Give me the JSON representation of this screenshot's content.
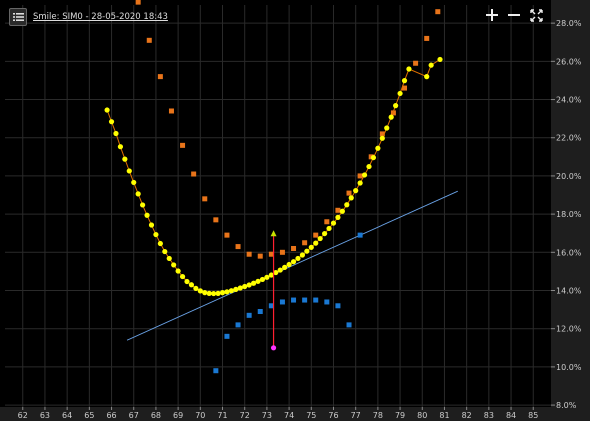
{
  "header": {
    "title": "Smile: SIM0 - 28-05-2020 18:43",
    "menu_icon": "list-icon",
    "tools": [
      {
        "name": "zoom-in-icon"
      },
      {
        "name": "zoom-out-icon"
      },
      {
        "name": "fit-icon"
      }
    ]
  },
  "colors": {
    "background": "#000000",
    "axis_panel": "#1e1e1e",
    "smile": "#ffff00",
    "smile_line": "#e07000",
    "ask": "#e8741a",
    "bid": "#1a78d2",
    "trend": "#6aa2e6",
    "marker_line": "#ff2030",
    "marker_top": "#c8e000",
    "marker_bottom": "#ff33ff",
    "grid": "#2a2a2a"
  },
  "chart_data": {
    "type": "scatter",
    "x_ticks": [
      "62",
      "63",
      "64",
      "65",
      "66",
      "67",
      "68",
      "69",
      "70",
      "71",
      "72",
      "73",
      "74",
      "75",
      "76",
      "77",
      "78",
      "79",
      "80",
      "81",
      "82",
      "83",
      "84",
      "85"
    ],
    "y_ticks": [
      "8.0%",
      "10.0%",
      "12.0%",
      "14.0%",
      "16.0%",
      "18.0%",
      "20.0%",
      "22.0%",
      "24.0%",
      "26.0%",
      "28.0%"
    ],
    "xlim": [
      61.2,
      85.8
    ],
    "ylim": [
      7.9,
      28.95
    ],
    "grid": true,
    "series": [
      {
        "name": "",
        "kind": "smile",
        "points": [
          [
            65.8,
            23.45
          ],
          [
            66.0,
            22.84
          ],
          [
            66.2,
            22.22
          ],
          [
            66.4,
            21.53
          ],
          [
            66.6,
            20.88
          ],
          [
            66.8,
            20.26
          ],
          [
            67.0,
            19.66
          ],
          [
            67.2,
            19.06
          ],
          [
            67.4,
            18.48
          ],
          [
            67.6,
            17.94
          ],
          [
            67.8,
            17.43
          ],
          [
            68.0,
            16.93
          ],
          [
            68.2,
            16.46
          ],
          [
            68.4,
            16.04
          ],
          [
            68.6,
            15.68
          ],
          [
            68.8,
            15.34
          ],
          [
            69.0,
            15.02
          ],
          [
            69.2,
            14.73
          ],
          [
            69.4,
            14.47
          ],
          [
            69.6,
            14.3
          ],
          [
            69.8,
            14.11
          ],
          [
            70.0,
            13.98
          ],
          [
            70.2,
            13.89
          ],
          [
            70.4,
            13.85
          ],
          [
            70.6,
            13.84
          ],
          [
            70.8,
            13.85
          ],
          [
            71.0,
            13.89
          ],
          [
            71.2,
            13.93
          ],
          [
            71.4,
            13.99
          ],
          [
            71.6,
            14.06
          ],
          [
            71.8,
            14.13
          ],
          [
            72.0,
            14.21
          ],
          [
            72.2,
            14.29
          ],
          [
            72.4,
            14.38
          ],
          [
            72.6,
            14.48
          ],
          [
            72.8,
            14.58
          ],
          [
            73.0,
            14.69
          ],
          [
            73.2,
            14.81
          ],
          [
            73.4,
            14.94
          ],
          [
            73.6,
            15.07
          ],
          [
            73.8,
            15.21
          ],
          [
            74.0,
            15.36
          ],
          [
            74.2,
            15.51
          ],
          [
            74.4,
            15.68
          ],
          [
            74.6,
            15.86
          ],
          [
            74.8,
            16.06
          ],
          [
            75.0,
            16.26
          ],
          [
            75.2,
            16.48
          ],
          [
            75.4,
            16.72
          ],
          [
            75.6,
            16.98
          ],
          [
            75.8,
            17.25
          ],
          [
            76.0,
            17.53
          ],
          [
            76.2,
            17.83
          ],
          [
            76.4,
            18.15
          ],
          [
            76.6,
            18.49
          ],
          [
            76.8,
            18.85
          ],
          [
            77.0,
            19.23
          ],
          [
            77.2,
            19.63
          ],
          [
            77.4,
            20.05
          ],
          [
            77.6,
            20.49
          ],
          [
            77.8,
            20.96
          ],
          [
            78.0,
            21.45
          ],
          [
            78.2,
            21.97
          ],
          [
            78.4,
            22.51
          ],
          [
            78.6,
            23.08
          ],
          [
            78.8,
            23.68
          ],
          [
            79.0,
            24.32
          ],
          [
            79.2,
            24.99
          ],
          [
            79.4,
            25.6
          ],
          [
            80.2,
            25.2
          ],
          [
            80.4,
            25.8
          ],
          [
            80.8,
            26.1
          ]
        ]
      },
      {
        "name": "",
        "kind": "ask",
        "points": [
          [
            67.2,
            29.1
          ],
          [
            67.7,
            27.1
          ],
          [
            68.2,
            25.2
          ],
          [
            68.7,
            23.4
          ],
          [
            69.2,
            21.6
          ],
          [
            69.7,
            20.1
          ],
          [
            70.2,
            18.8
          ],
          [
            70.7,
            17.7
          ],
          [
            71.2,
            16.9
          ],
          [
            71.7,
            16.3
          ],
          [
            72.2,
            15.9
          ],
          [
            72.7,
            15.8
          ],
          [
            73.2,
            15.9
          ],
          [
            73.7,
            16.0
          ],
          [
            74.2,
            16.2
          ],
          [
            74.7,
            16.5
          ],
          [
            75.2,
            16.9
          ],
          [
            75.7,
            17.6
          ],
          [
            76.2,
            18.2
          ],
          [
            76.7,
            19.1
          ],
          [
            77.2,
            20.0
          ],
          [
            77.7,
            21.0
          ],
          [
            78.2,
            22.2
          ],
          [
            78.7,
            23.3
          ],
          [
            79.2,
            24.6
          ],
          [
            79.7,
            25.9
          ],
          [
            80.2,
            27.2
          ],
          [
            80.7,
            28.6
          ]
        ]
      },
      {
        "name": "",
        "kind": "bid",
        "points": [
          [
            70.7,
            9.8
          ],
          [
            71.2,
            11.6
          ],
          [
            71.7,
            12.2
          ],
          [
            72.2,
            12.7
          ],
          [
            72.7,
            12.9
          ],
          [
            73.2,
            13.2
          ],
          [
            73.7,
            13.4
          ],
          [
            74.2,
            13.5
          ],
          [
            74.7,
            13.5
          ],
          [
            75.2,
            13.5
          ],
          [
            75.7,
            13.4
          ],
          [
            76.2,
            13.2
          ],
          [
            76.7,
            12.2
          ],
          [
            77.2,
            16.9
          ]
        ]
      }
    ],
    "trendline": [
      [
        66.7,
        11.4
      ],
      [
        81.6,
        19.2
      ]
    ],
    "marker": {
      "x": 73.3,
      "y_top": 17.0,
      "y_bottom": 11.0
    }
  }
}
